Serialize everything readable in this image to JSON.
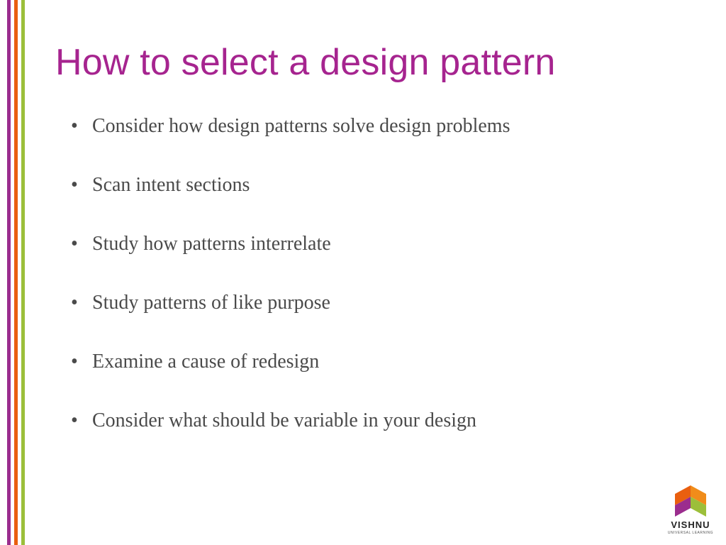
{
  "title": "How to select a design pattern",
  "bullets": [
    "Consider how design patterns solve design problems",
    "Scan intent sections",
    "Study how patterns interrelate",
    "Study patterns of like purpose",
    "Examine a cause of redesign",
    "Consider what should be variable in your design"
  ],
  "logo": {
    "name": "VISHNU",
    "tagline": "UNIVERSAL LEARNING"
  },
  "colors": {
    "title": "#a6248f",
    "stripe_purple": "#9b2d8e",
    "stripe_orange": "#e95f0f",
    "stripe_green": "#9cbf3a",
    "body_text": "#4a4a4a"
  }
}
